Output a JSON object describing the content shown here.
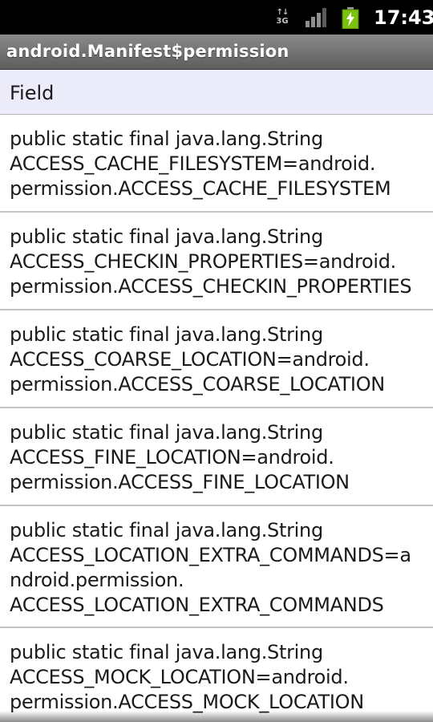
{
  "status_bar": {
    "network_type": "3G",
    "time": "17:43",
    "icons": [
      "network-3g-icon",
      "signal-strength-icon",
      "battery-charging-icon"
    ],
    "battery_color": "#7dc10f"
  },
  "title_bar": {
    "title": "android.Manifest$permission"
  },
  "list": {
    "header": "Field",
    "rows": [
      {
        "lines": [
          "public static final java.lang.String",
          "ACCESS_CACHE_FILESYSTEM=android.",
          "permission.ACCESS_CACHE_FILESYSTEM"
        ]
      },
      {
        "lines": [
          "public static final java.lang.String",
          "ACCESS_CHECKIN_PROPERTIES=android.",
          "permission.ACCESS_CHECKIN_PROPERTIES"
        ]
      },
      {
        "lines": [
          "public static final java.lang.String",
          "ACCESS_COARSE_LOCATION=android.",
          "permission.ACCESS_COARSE_LOCATION"
        ]
      },
      {
        "lines": [
          "public static final java.lang.String",
          "ACCESS_FINE_LOCATION=android.",
          "permission.ACCESS_FINE_LOCATION"
        ]
      },
      {
        "lines": [
          "public static final java.lang.String",
          "ACCESS_LOCATION_EXTRA_COMMANDS=a",
          "ndroid.permission.",
          "ACCESS_LOCATION_EXTRA_COMMANDS"
        ]
      },
      {
        "lines": [
          "public static final java.lang.String",
          "ACCESS_MOCK_LOCATION=android.",
          "permission.ACCESS_MOCK_LOCATION"
        ]
      }
    ]
  }
}
